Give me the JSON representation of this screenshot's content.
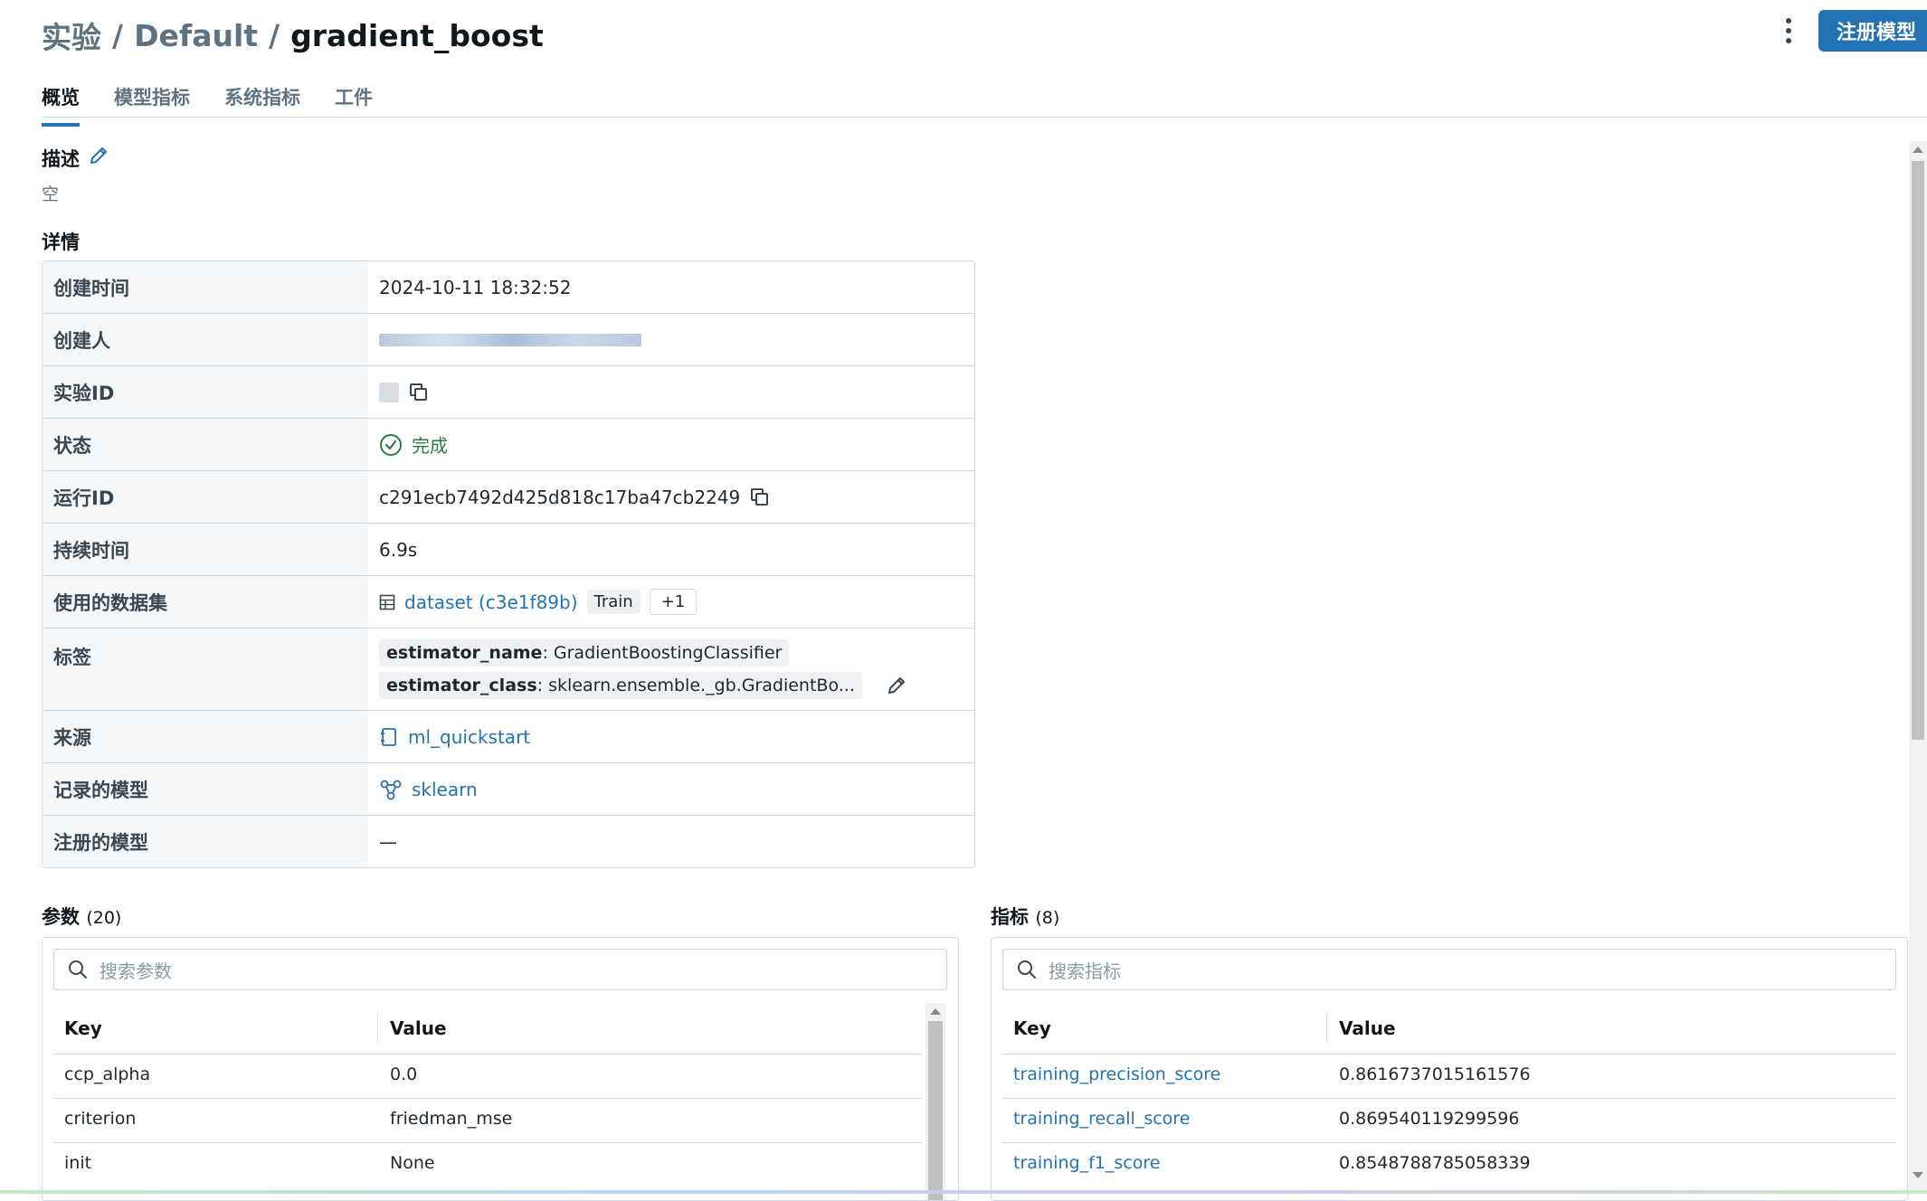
{
  "breadcrumb": {
    "root": "实验",
    "sep": "/",
    "experiment": "Default",
    "run": "gradient_boost"
  },
  "actions": {
    "register_label": "注册模型"
  },
  "tabs": [
    {
      "label": "概览",
      "active": true
    },
    {
      "label": "模型指标",
      "active": false
    },
    {
      "label": "系统指标",
      "active": false
    },
    {
      "label": "工件",
      "active": false
    }
  ],
  "description": {
    "title": "描述",
    "empty_text": "空"
  },
  "details": {
    "title": "详情",
    "rows": {
      "created_at": {
        "label": "创建时间",
        "value": "2024-10-11 18:32:52"
      },
      "creator": {
        "label": "创建人"
      },
      "experiment_id": {
        "label": "实验ID"
      },
      "status": {
        "label": "状态",
        "value": "完成"
      },
      "run_id": {
        "label": "运行ID",
        "value": "c291ecb7492d425d818c17ba47cb2249"
      },
      "duration": {
        "label": "持续时间",
        "value": "6.9s"
      },
      "datasets": {
        "label": "使用的数据集",
        "dataset_link": "dataset (c3e1f89b)",
        "context_tag": "Train",
        "more": "+1"
      },
      "tags": {
        "label": "标签",
        "items": [
          {
            "key": "estimator_name",
            "value": ": GradientBoostingClassifier"
          },
          {
            "key": "estimator_class",
            "value": ": sklearn.ensemble._gb.GradientBo..."
          }
        ]
      },
      "source": {
        "label": "来源",
        "value": "ml_quickstart"
      },
      "logged_models": {
        "label": "记录的模型",
        "value": "sklearn"
      },
      "registered_models": {
        "label": "注册的模型",
        "value": "—"
      }
    }
  },
  "params": {
    "title": "参数",
    "count": "(20)",
    "search_placeholder": "搜索参数",
    "col_key": "Key",
    "col_value": "Value",
    "rows": [
      {
        "key": "ccp_alpha",
        "value": "0.0"
      },
      {
        "key": "criterion",
        "value": "friedman_mse"
      },
      {
        "key": "init",
        "value": "None"
      }
    ]
  },
  "metrics": {
    "title": "指标",
    "count": "(8)",
    "search_placeholder": "搜索指标",
    "col_key": "Key",
    "col_value": "Value",
    "rows": [
      {
        "key": "training_precision_score",
        "value": "0.8616737015161576"
      },
      {
        "key": "training_recall_score",
        "value": "0.869540119299596"
      },
      {
        "key": "training_f1_score",
        "value": "0.8548788785058339"
      }
    ]
  },
  "colors": {
    "accent": "#2272b4",
    "success": "#277c43",
    "border": "#d1d9e1",
    "label_bg": "#f5f7f9"
  }
}
